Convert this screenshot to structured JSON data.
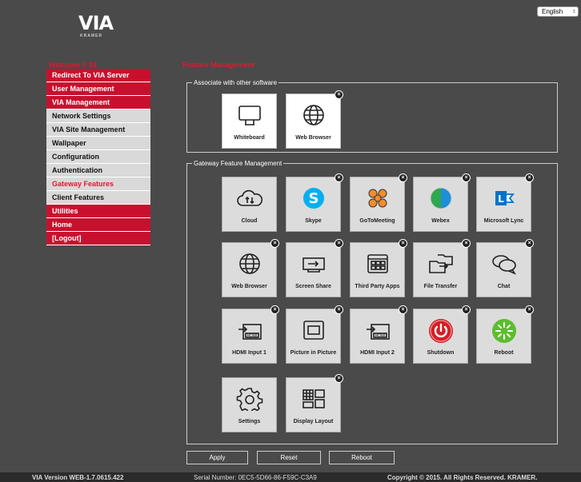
{
  "language": {
    "selected": "English"
  },
  "logo": {
    "brand": "VIA",
    "sub": "KRAMER"
  },
  "welcome": "Welcome !! 01",
  "sidebar": {
    "items": [
      {
        "label": "Redirect To VIA Server",
        "style": "red"
      },
      {
        "label": "User Management",
        "style": "red"
      },
      {
        "label": "VIA Management",
        "style": "red"
      },
      {
        "label": "Network Settings",
        "style": "grey"
      },
      {
        "label": "VIA Site Management",
        "style": "grey"
      },
      {
        "label": "Wallpaper",
        "style": "grey"
      },
      {
        "label": "Configuration",
        "style": "grey"
      },
      {
        "label": "Authentication",
        "style": "grey"
      },
      {
        "label": "Gateway Features",
        "style": "grey-active"
      },
      {
        "label": "Client Features",
        "style": "grey"
      },
      {
        "label": "Utilities",
        "style": "red"
      },
      {
        "label": "Home",
        "style": "red"
      },
      {
        "label": "[Logout]",
        "style": "red"
      }
    ]
  },
  "main": {
    "title": "Feature Management",
    "associate": {
      "legend": "Associate with other software",
      "tiles": [
        {
          "label": "Whiteboard",
          "icon": "whiteboard-icon",
          "closable": false
        },
        {
          "label": "Web Browser",
          "icon": "globe-icon",
          "closable": true
        }
      ]
    },
    "gateway": {
      "legend": "Gateway Feature Management",
      "rows": [
        [
          {
            "label": "Cloud",
            "icon": "cloud-icon",
            "closable": false
          },
          {
            "label": "Skype",
            "icon": "skype-icon",
            "closable": true
          },
          {
            "label": "GoToMeeting",
            "icon": "gotomeeting-icon",
            "closable": true
          },
          {
            "label": "Webex",
            "icon": "webex-icon",
            "closable": true
          },
          {
            "label": "Microsoft Lync",
            "icon": "lync-icon",
            "closable": true
          }
        ],
        [
          {
            "label": "Web Browser",
            "icon": "globe-icon",
            "closable": true
          },
          {
            "label": "Screen Share",
            "icon": "screen-share-icon",
            "closable": true
          },
          {
            "label": "Third Party Apps",
            "icon": "apps-icon",
            "closable": true
          },
          {
            "label": "File Transfer",
            "icon": "file-transfer-icon",
            "closable": true
          },
          {
            "label": "Chat",
            "icon": "chat-icon",
            "closable": true
          }
        ],
        [
          {
            "label": "HDMI Input 1",
            "icon": "hdmi-icon",
            "closable": true
          },
          {
            "label": "Picture in Picture",
            "icon": "pip-icon",
            "closable": true
          },
          {
            "label": "HDMI Input 2",
            "icon": "hdmi-icon",
            "closable": true
          },
          {
            "label": "Shutdown",
            "icon": "power-icon",
            "closable": true
          },
          {
            "label": "Reboot",
            "icon": "reboot-icon",
            "closable": true
          }
        ],
        [
          {
            "label": "Settings",
            "icon": "gear-icon",
            "closable": false
          },
          {
            "label": "Display Layout",
            "icon": "layout-icon",
            "closable": true
          }
        ]
      ]
    }
  },
  "buttons": {
    "apply": "Apply",
    "reset": "Reset",
    "reboot": "Reboot"
  },
  "footer": {
    "version": "VIA Version WEB-1.7.0615.422",
    "serial": "Serial Number: 0EC5-5D66-86-F59C-C3A9",
    "copyright": "Copyright © 2015. All Rights Reserved. KRAMER."
  },
  "colors": {
    "brand_red": "#c8102e",
    "background": "#4a4a4a",
    "tile_grey": "#dcdcdc"
  }
}
